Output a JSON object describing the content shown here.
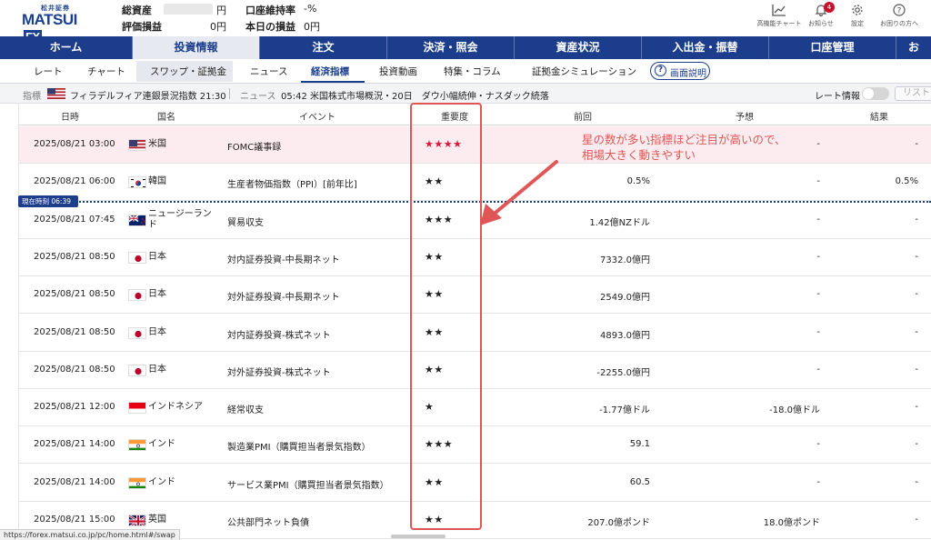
{
  "header": {
    "logo_small": "松井証券",
    "logo_main": "MATSUI",
    "logo_fx": "FX",
    "total_assets_label": "総資産",
    "total_assets_unit": "円",
    "pnl_label": "評価損益",
    "pnl_value": "0円",
    "margin_label": "口座維持率",
    "margin_value": "-%",
    "today_pnl_label": "本日の損益",
    "today_pnl_value": "0円",
    "icons": [
      {
        "icon": "chart-icon",
        "label": "高機能チャート"
      },
      {
        "icon": "bell-icon",
        "label": "お知らせ",
        "badge": "4"
      },
      {
        "icon": "gear-icon",
        "label": "設定"
      },
      {
        "icon": "help-icon",
        "label": "お困りの方へ"
      }
    ]
  },
  "main_nav": [
    "ホーム",
    "投資情報",
    "注文",
    "決済・照会",
    "資産状況",
    "入出金・振替",
    "口座管理",
    "お"
  ],
  "main_nav_active": "投資情報",
  "sub_nav": [
    "レート",
    "チャート",
    "スワップ・証拠金",
    "ニュース",
    "経済指標",
    "投資動画",
    "特集・コラム",
    "証拠金シミュレーション"
  ],
  "sub_nav_active": "経済指標",
  "help_button": "画面説明",
  "ticker": {
    "indicator_label": "指標",
    "indicator_text": "フィラデルフィア連銀景況指数 21:30",
    "news_label": "ニュース",
    "news_text": "05:42 米国株式市場概況・20日　ダウ小幅続伸・ナスダック続落",
    "rate_info_label": "レート情報",
    "list_button": "リスト"
  },
  "table": {
    "headers": [
      "日時",
      "国名",
      "イベント",
      "重要度",
      "前回",
      "予想",
      "結果"
    ],
    "rows": [
      {
        "datetime": "2025/08/21 03:00",
        "country": "米国",
        "flag": "us",
        "event": "FOMC議事録",
        "stars": "★★★★",
        "prev": "-",
        "forecast": "-",
        "result": "-",
        "highlight": true
      },
      {
        "datetime": "2025/08/21 06:00",
        "country": "韓国",
        "flag": "kr",
        "event": "生産者物価指数（PPI）[前年比]",
        "stars": "★★",
        "prev": "0.5%",
        "forecast": "-",
        "result": "0.5%",
        "highlight": false
      },
      {
        "datetime": "2025/08/21 07:45",
        "country": "ニュージーランド",
        "flag": "nz",
        "event": "貿易収支",
        "stars": "★★★",
        "prev": "1.42億NZドル",
        "forecast": "-",
        "result": "-",
        "highlight": false
      },
      {
        "datetime": "2025/08/21 08:50",
        "country": "日本",
        "flag": "jp",
        "event": "対内証券投資-中長期ネット",
        "stars": "★★",
        "prev": "7332.0億円",
        "forecast": "-",
        "result": "-",
        "highlight": false
      },
      {
        "datetime": "2025/08/21 08:50",
        "country": "日本",
        "flag": "jp",
        "event": "対外証券投資-中長期ネット",
        "stars": "★★",
        "prev": "2549.0億円",
        "forecast": "-",
        "result": "-",
        "highlight": false
      },
      {
        "datetime": "2025/08/21 08:50",
        "country": "日本",
        "flag": "jp",
        "event": "対内証券投資-株式ネット",
        "stars": "★★",
        "prev": "4893.0億円",
        "forecast": "-",
        "result": "-",
        "highlight": false
      },
      {
        "datetime": "2025/08/21 08:50",
        "country": "日本",
        "flag": "jp",
        "event": "対外証券投資-株式ネット",
        "stars": "★★",
        "prev": "-2255.0億円",
        "forecast": "-",
        "result": "-",
        "highlight": false
      },
      {
        "datetime": "2025/08/21 12:00",
        "country": "インドネシア",
        "flag": "id",
        "event": "経常収支",
        "stars": "★",
        "prev": "-1.77億ドル",
        "forecast": "-18.0億ドル",
        "result": "-",
        "highlight": false
      },
      {
        "datetime": "2025/08/21 14:00",
        "country": "インド",
        "flag": "in",
        "event": "製造業PMI（購買担当者景気指数）",
        "stars": "★★★",
        "prev": "59.1",
        "forecast": "-",
        "result": "-",
        "highlight": false
      },
      {
        "datetime": "2025/08/21 14:00",
        "country": "インド",
        "flag": "in",
        "event": "サービス業PMI（購買担当者景気指数）",
        "stars": "★★",
        "prev": "60.5",
        "forecast": "-",
        "result": "-",
        "highlight": false
      },
      {
        "datetime": "2025/08/21 15:00",
        "country": "英国",
        "flag": "gb",
        "event": "公共部門ネット負債",
        "stars": "★★",
        "prev": "207.0億ポンド",
        "forecast": "18.0億ポンド",
        "result": "-",
        "highlight": false
      }
    ]
  },
  "now_marker": "現在時刻 06:39",
  "annotation": {
    "line1": "星の数が多い指標ほど注目が高いので、",
    "line2": "相場大きく動きやすい",
    "color": "#e05555"
  },
  "status_url": "https://forex.matsui.co.jp/pc/home.html#/swap",
  "colors": {
    "brand": "#1b3d8c",
    "highlight_row": "#fdecef",
    "important_star": "#e0153a"
  }
}
